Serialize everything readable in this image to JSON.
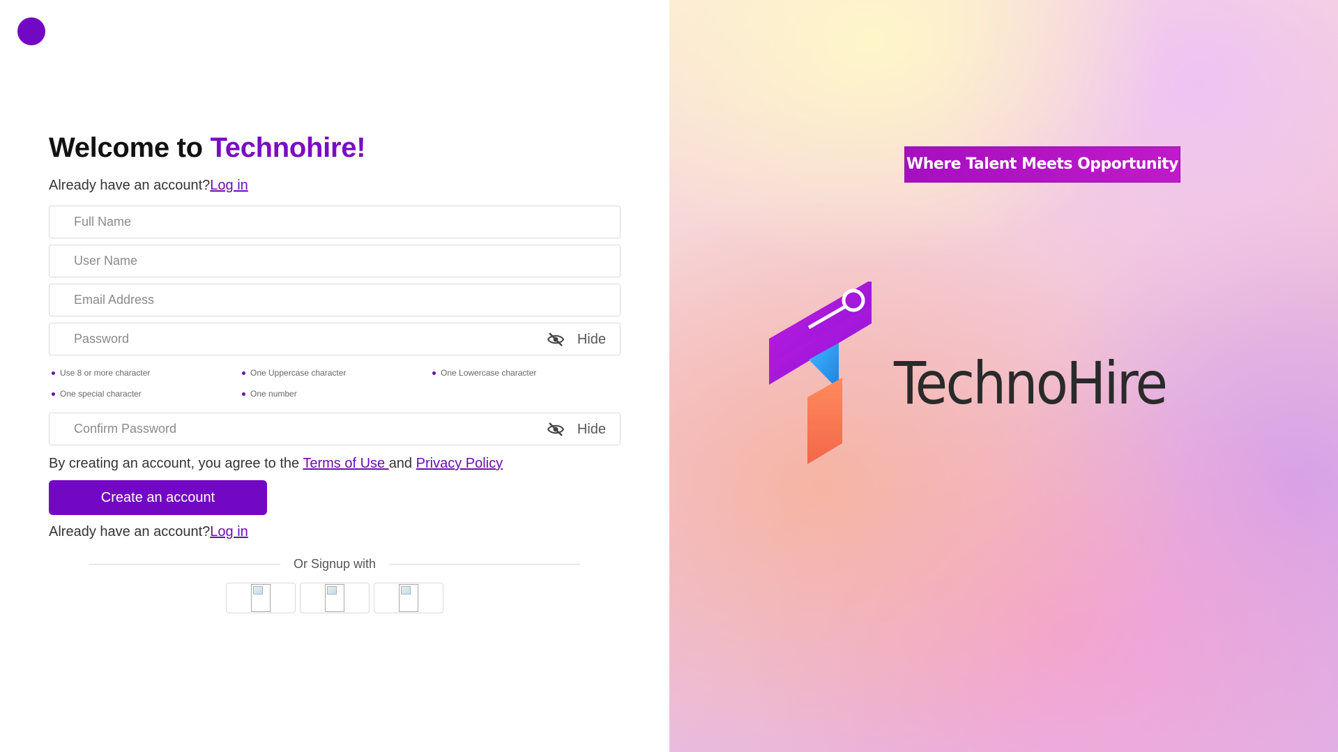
{
  "header": {
    "title_prefix": "Welcome to ",
    "title_brand": "Technohire!"
  },
  "login_prompt": {
    "text": "Already have an account?",
    "link": "Log in"
  },
  "fields": {
    "full_name_placeholder": "Full Name",
    "user_name_placeholder": "User Name",
    "email_placeholder": "Email Address",
    "password_placeholder": "Password",
    "confirm_password_placeholder": "Confirm Password",
    "hide_label": "Hide"
  },
  "password_requirements": [
    "Use 8 or more character",
    "One Uppercase character",
    "One Lowercase character",
    "One special character",
    "One number"
  ],
  "terms": {
    "prefix": "By creating an account, you agree to the ",
    "terms_link": "Terms of Use ",
    "middle": "and ",
    "privacy_link": "Privacy Policy"
  },
  "create_button_label": "Create an account",
  "divider_text": "Or Signup with",
  "brand_panel": {
    "name": "TechnoHire",
    "tagline": "Where Talent Meets Opportunity"
  },
  "colors": {
    "accent": "#7207c4",
    "link": "#6a0dad"
  }
}
